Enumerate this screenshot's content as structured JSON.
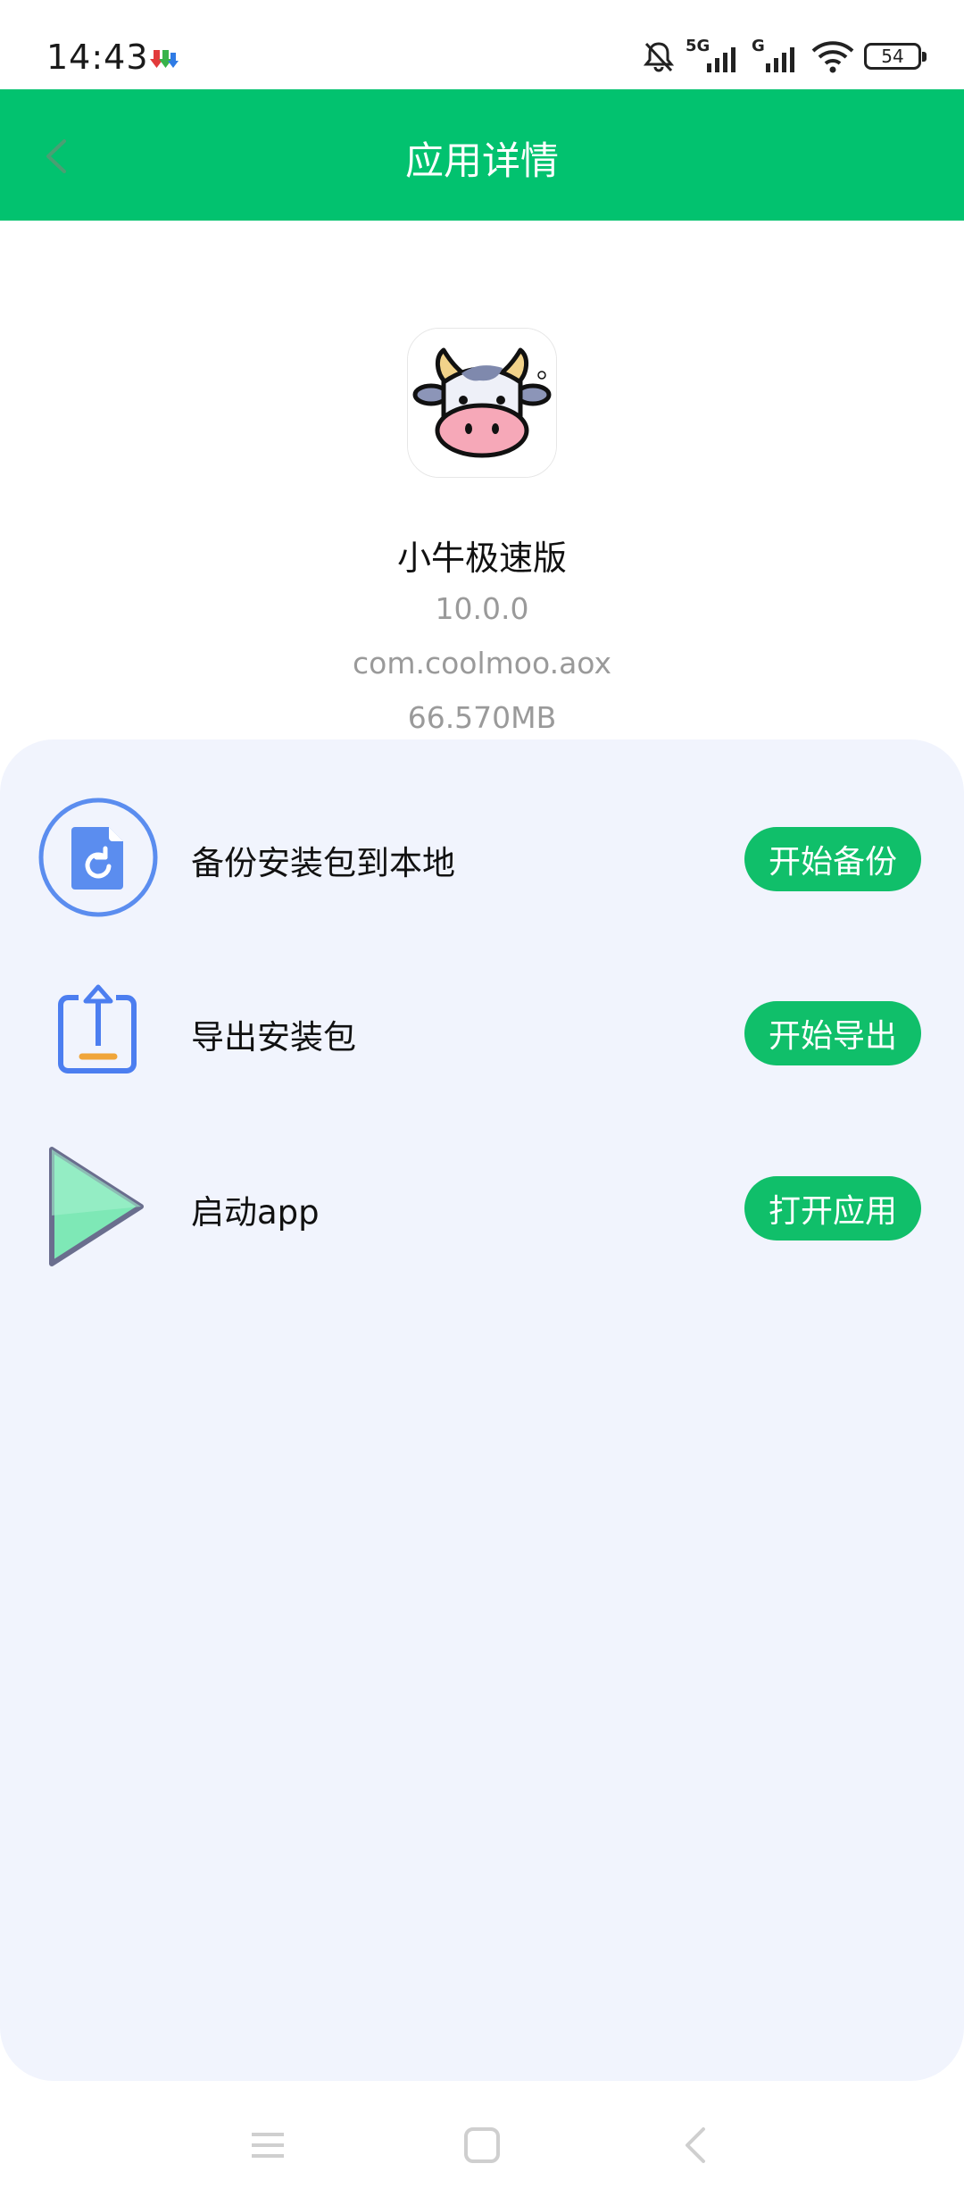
{
  "status": {
    "time": "14:43",
    "battery": "54",
    "net1": "5G",
    "net2": "G"
  },
  "header": {
    "title": "应用详情"
  },
  "app": {
    "name": "小牛极速版",
    "version": "10.0.0",
    "package": "com.coolmoo.aox",
    "size": "66.570MB"
  },
  "actions": [
    {
      "label": "备份安装包到本地",
      "button": "开始备份",
      "icon": "backup-file-icon"
    },
    {
      "label": "导出安装包",
      "button": "开始导出",
      "icon": "export-upload-icon"
    },
    {
      "label": "启动app",
      "button": "打开应用",
      "icon": "play-icon"
    }
  ],
  "colors": {
    "primary": "#02c26f",
    "button": "#10bf6a",
    "panel": "#f1f4fd"
  }
}
